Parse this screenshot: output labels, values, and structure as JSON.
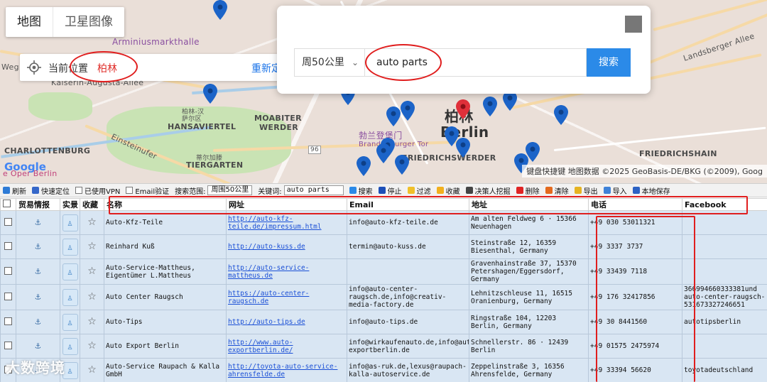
{
  "map": {
    "type_buttons": [
      "地图",
      "卫星图像"
    ],
    "labels": {
      "arminius": "Arminiusmarkthalle",
      "moabiter": "MOABITER",
      "werder": "WERDER",
      "hansaviertel": "HANSAVIERTEL",
      "hansa_cn": "柏林-汉",
      "hansa_cn2": "萨尔区",
      "charlottenburg": "CHARLOTTENBURG",
      "tiergarten": "TIERGARTEN",
      "tiergarten_cn": "蒂尔加滕",
      "friedrichswerder": "FRIEDRICHSWERDER",
      "friedrichshain": "FRIEDRICHSHAIN",
      "brandenburg": "Brandenburger Tor",
      "brandenburg_cn": "勃兰登堡门",
      "berlin_cn": "柏林",
      "berlin": "Berlin",
      "landsberger": "Landsberger Allee",
      "kaiserin": "Kaiserin-Augusta-Allee",
      "einsteinufer": "Einsteinufer",
      "weg": "Weg",
      "oper": "e Oper Berlin",
      "road96": "96"
    },
    "attribution": "键盘快捷键   地图数据 ©2025 GeoBasis-DE/BKG (©2009), Goog",
    "google_logo": "Google"
  },
  "location": {
    "label": "当前位置",
    "city": "柏林",
    "relocate": "重新定位"
  },
  "search": {
    "range": "周50公里",
    "keyword": "auto parts",
    "button": "搜索"
  },
  "toolbar": {
    "refresh": "刷新",
    "quick_locate": "快速定位",
    "vpn": "已使用VPN",
    "email_verify": "Email验证",
    "range_label": "搜索范围:",
    "range_value": "周围50公里",
    "keyword_label": "关键词:",
    "keyword_value": "auto parts",
    "search": "搜索",
    "stop": "停止",
    "filter": "过滤",
    "favorite": "收藏",
    "decision": "决策人挖掘",
    "delete": "删除",
    "clear": "清除",
    "export": "导出",
    "import": "导入",
    "local_save": "本地保存"
  },
  "colors": {
    "accent_blue": "#2b8ae8",
    "annotation_red": "#e01e1e",
    "grid_bg": "#d9e6f3"
  },
  "table": {
    "headers": [
      "贸易情报",
      "实景",
      "收藏",
      "名称",
      "网址",
      "Email",
      "地址",
      "电话",
      "Facebook"
    ],
    "rows": [
      {
        "name": "Auto-Kfz-Teile",
        "url": "http://auto-kfz-teile.de/impressum.html",
        "email": "info@auto-kfz-teile.de",
        "address": "Am alten Feldweg 6 · 15366 Neuenhagen",
        "phone": "+49 030 53011321",
        "facebook": ""
      },
      {
        "name": "Reinhard Kuß",
        "url": "http://auto-kuss.de",
        "email": "termin@auto-kuss.de",
        "address": "Steinstraße 12, 16359 Biesenthal, Germany",
        "phone": "+49 3337 3737",
        "facebook": ""
      },
      {
        "name": "Auto-Service-Mattheus, Eigentümer L.Mattheus",
        "url": "http://auto-service-mattheus.de",
        "email": "",
        "address": "Gravenhainstraße 37, 15370 Petershagen/Eggersdorf, Germany",
        "phone": "+49 33439 7118",
        "facebook": ""
      },
      {
        "name": "Auto Center Raugsch",
        "url": "https://auto-center-raugsch.de",
        "email": "info@auto-center-raugsch.de,info@creativ-media-factory.de",
        "address": "Lehnitzschleuse 11, 16515 Oranienburg, Germany",
        "phone": "+49 176 32417856",
        "facebook": "366994660333381und auto-center-raugsch-531673327246651"
      },
      {
        "name": "Auto-Tips",
        "url": "http://auto-tips.de",
        "email": "info@auto-tips.de",
        "address": "Ringstraße 104, 12203 Berlin, Germany",
        "phone": "+49 30 8441560",
        "facebook": "autotipsberlin"
      },
      {
        "name": "Auto Export Berlin",
        "url": "http://www.auto-exportberlin.de/",
        "email": "info@wirkaufenauto.de,info@auto-exportberlin.de",
        "address": "Schnellerstr. 86 · 12439 Berlin",
        "phone": "+49 01575 2475974",
        "facebook": ""
      },
      {
        "name": "Auto-Service Raupach & Kalla GmbH",
        "url": "http://toyota-auto-service-ahrensfelde.de",
        "email": "info@as-ruk.de,lexus@raupach-kalla-autoservice.de",
        "address": "Zeppelinstraße 3, 16356 Ahrensfelde, Germany",
        "phone": "+49 33394 56620",
        "facebook": "toyotadeutschland"
      }
    ]
  },
  "watermark": "大数跨境"
}
